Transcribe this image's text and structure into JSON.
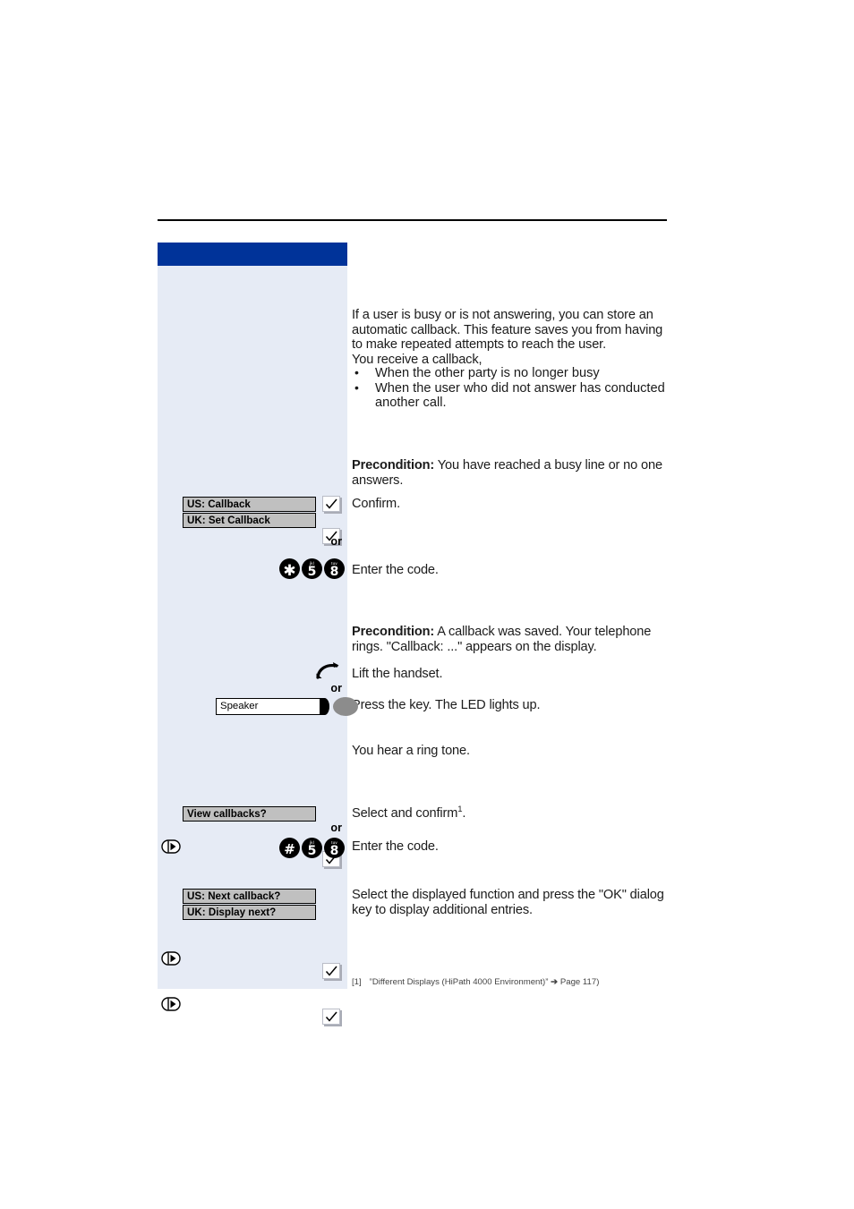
{
  "theme": {
    "accent_blue": "#003399",
    "panel_bg": "#e6ebf5",
    "display_key_bg": "#c0c0c0",
    "led_key_gray": "#8c8c8c"
  },
  "content": {
    "intro_paragraph": "If a user is busy or is not answering, you can store an automatic callback. This feature saves you from having to make repeated attempts to reach the user.",
    "receive_lead": "You receive a callback,",
    "bullets": [
      "When the other party is no longer busy",
      "When the user who did not answer has conducted another call."
    ],
    "precondition_label": "Precondition:",
    "precondition_1": " You have reached a busy line or no one answers.",
    "precondition_2": " A callback was saved. Your telephone rings. \"Callback: ...\" appears on the display.",
    "confirm": "Confirm.",
    "enter_code_1": "Enter the code.",
    "lift_handset": "Lift the handset.",
    "press_key_led": "Press the key. The LED lights up.",
    "ring_tone": "You hear a ring tone.",
    "select_and_confirm": "Select and confirm",
    "select_and_confirm_sup": "1",
    "select_and_confirm_end": ".",
    "enter_code_2": "Enter the code.",
    "select_displayed": "Select the displayed function and press the \"OK\" dialog key to display additional entries.",
    "or": "or"
  },
  "keys": {
    "display_keys": {
      "us_callback": "US: Callback",
      "uk_set_callback": "UK: Set Callback",
      "view_callbacks": "View callbacks?",
      "us_next_callback": "US: Next callback?",
      "uk_display_next": "UK: Display next?"
    },
    "function_key": {
      "speaker_label": "Speaker"
    },
    "code_1": [
      {
        "glyph": "✱",
        "sub": ""
      },
      {
        "glyph": "5",
        "sub": "jkl"
      },
      {
        "glyph": "8",
        "sub": "tuv"
      }
    ],
    "code_2": [
      {
        "glyph": "#",
        "sub": ""
      },
      {
        "glyph": "5",
        "sub": "jkl"
      },
      {
        "glyph": "8",
        "sub": "tuv"
      }
    ]
  },
  "footnote": {
    "number": "[1]",
    "text": "”Different Displays (HiPath 4000 Environment)”",
    "arrow": "➔",
    "page_ref": "Page 117)"
  },
  "icons": {
    "checkmark": "check-icon",
    "navigator": "navigation-rocker-icon",
    "handset": "handset-lift-icon",
    "speaker_led": "led-indicator-icon"
  }
}
